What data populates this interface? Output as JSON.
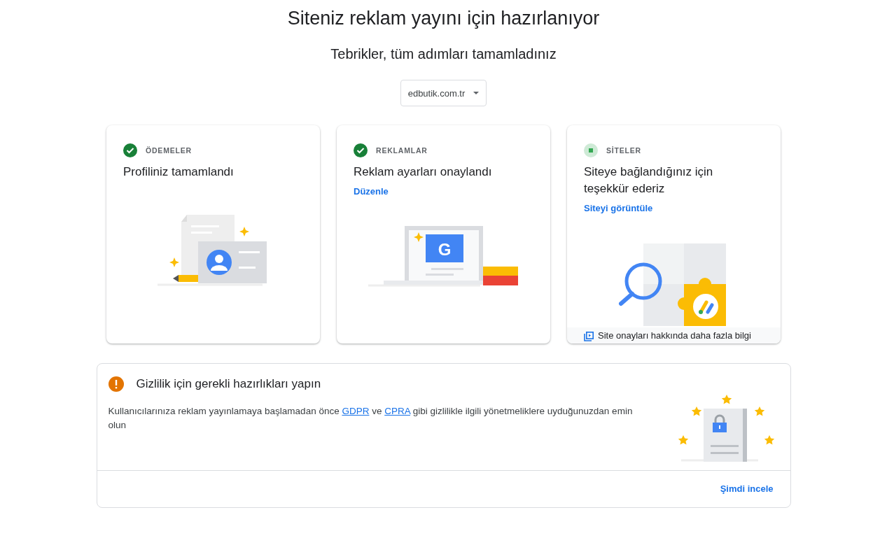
{
  "title": "Siteniz reklam yayını için hazırlanıyor",
  "subtitle": "Tebrikler, tüm adımları tamamladınız",
  "site_dropdown": {
    "value": "edbutik.com.tr"
  },
  "cards": [
    {
      "completed": true,
      "kind": "profile",
      "category": "ÖDEMELER",
      "heading": "Profiliniz tamamlandı"
    },
    {
      "completed": true,
      "kind": "ads",
      "category": "REKLAMLAR",
      "heading": "Reklam ayarları onaylandı",
      "link": "Düzenle",
      "logo_letter": "G"
    },
    {
      "completed": false,
      "kind": "sites",
      "category": "SİTELER",
      "heading": "Siteye bağlandığınız için teşekkür ederiz",
      "link": "Siteyi görüntüle",
      "footer_link": "Site onayları hakkında daha fazla bilgi"
    }
  ],
  "privacy": {
    "heading": "Gizlilik için gerekli hazırlıkları yapın",
    "text": [
      "Kullanıcılarınıza reklam yayınlamaya başlamadan önce ",
      "GDPR",
      " ve ",
      "CPRA",
      " gibi gizlilikle ilgili yönetmeliklere uyduğunuzdan emin olun"
    ],
    "action": "Şimdi incele"
  }
}
